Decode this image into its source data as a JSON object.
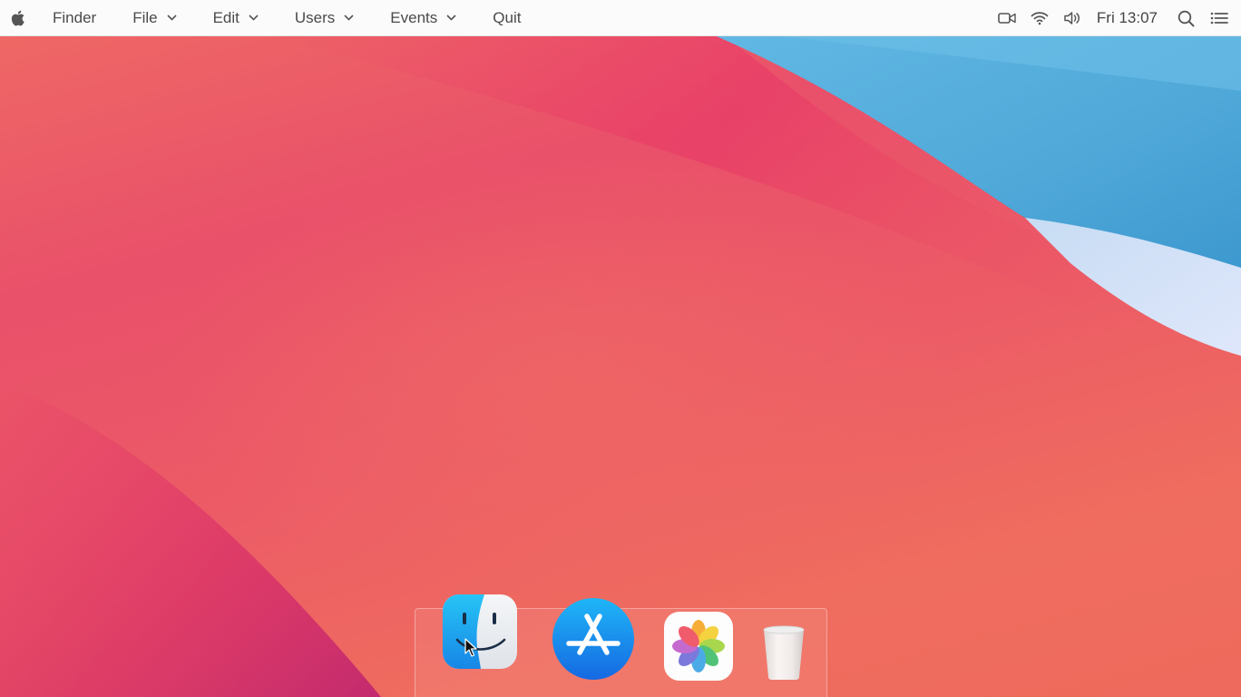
{
  "menubar": {
    "apple_icon": "apple-logo-icon",
    "items": [
      {
        "label": "Finder",
        "has_menu": false
      },
      {
        "label": "File",
        "has_menu": true
      },
      {
        "label": "Edit",
        "has_menu": true
      },
      {
        "label": "Users",
        "has_menu": true
      },
      {
        "label": "Events",
        "has_menu": true
      },
      {
        "label": "Quit",
        "has_menu": false
      }
    ],
    "status": {
      "icons": [
        "video-camera-icon",
        "wifi-icon",
        "volume-icon"
      ],
      "clock": "Fri 13:07",
      "right_icons": [
        "search-icon",
        "menu-list-icon"
      ]
    }
  },
  "dock": {
    "apps": [
      {
        "name": "Finder",
        "icon": "finder-icon"
      },
      {
        "name": "App Store",
        "icon": "app-store-icon"
      },
      {
        "name": "Photos",
        "icon": "photos-icon"
      },
      {
        "name": "Trash",
        "icon": "trash-icon"
      }
    ]
  },
  "colors": {
    "wallpaper_red": "#ea4c66",
    "wallpaper_blue": "#5eb3e0",
    "menubar_bg": "#fbfbfb"
  }
}
